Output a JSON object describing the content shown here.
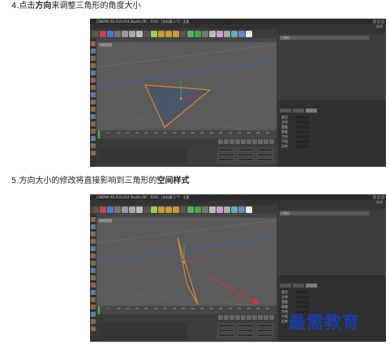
{
  "steps": [
    {
      "pre": "4.点击",
      "bold": "方向",
      "post": "来调整三角形的角度大小",
      "screenshot": {
        "window_title": "CINEMA 4D R19.024 Studio (RC - R19) - [未标题 1 *] - 主要",
        "layout_label": "启动",
        "viewport_label": "透视视图",
        "timeline_ticks": [
          "0",
          "5",
          "10",
          "15",
          "20",
          "25",
          "30",
          "35",
          "40",
          "45",
          "50",
          "55",
          "60",
          "65",
          "70",
          "75",
          "80",
          "85",
          "90"
        ],
        "object_rows": [
          "三角形"
        ],
        "attr_rows": [
          "类型",
          "半径",
          "宽度",
          "高度",
          "方向",
          "平面",
          "反转"
        ],
        "attr_tabs": [
          "基本",
          "坐标",
          "对象"
        ]
      }
    },
    {
      "pre": "5.方向大小的修改将直接影响到三角形的",
      "bold": "空间样式",
      "post": "",
      "screenshot": {
        "window_title": "CINEMA 4D R19.024 Studio (RC - R19) - [未标题 1 *] - 主要",
        "layout_label": "启动",
        "viewport_label": "透视视图",
        "timeline_ticks": [
          "0",
          "5",
          "10",
          "15",
          "20",
          "25",
          "30",
          "35",
          "40",
          "45",
          "50",
          "55",
          "60",
          "65",
          "70",
          "75",
          "80",
          "85",
          "90"
        ],
        "object_rows": [
          "三角形"
        ],
        "attr_rows": [
          "类型",
          "半径",
          "宽度",
          "高度",
          "方向",
          "平面",
          "反转"
        ],
        "attr_tabs": [
          "基本",
          "坐标",
          "对象"
        ]
      }
    }
  ],
  "watermark": "最需教育",
  "colors": {
    "accent_orange": "#e8872a",
    "highlight_red": "#e53030",
    "watermark_blue": "#1a3ea8",
    "axis_green": "#3cc43c",
    "axis_blue": "#3b5bd8"
  },
  "icons": [
    "app-logo-icon",
    "move-tool-icon",
    "rotate-tool-icon",
    "scale-tool-icon",
    "render-icon",
    "cube-icon",
    "spline-icon",
    "camera-icon",
    "light-icon",
    "play-icon"
  ]
}
